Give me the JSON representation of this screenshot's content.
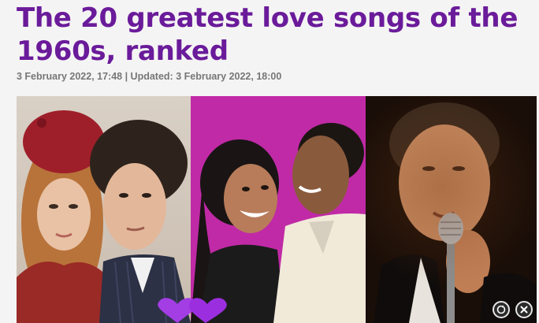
{
  "article": {
    "headline": "The 20 greatest love songs of the 1960s, ranked",
    "meta": "3 February 2022, 17:48 | Updated: 3 February 2022, 18:00"
  },
  "hero": {
    "panel_colors": [
      "#d0c5b8",
      "#c02aa6",
      "#1a0e08"
    ],
    "accent": "#6a1b9a"
  },
  "overlay": {
    "info_icon": "ad-info-icon",
    "close_icon": "close-icon"
  }
}
